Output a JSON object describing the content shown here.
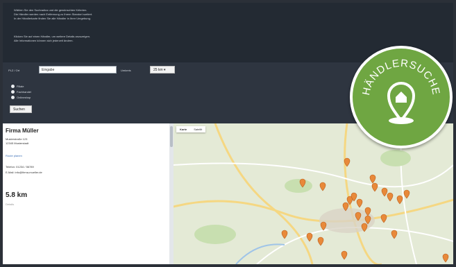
{
  "info": {
    "lines1": [
      "Wählen Sie den Suchradius und die gewünschten Kriterien.",
      "Die Händler werden nach Entfernung zu Ihrem Standort sortiert.",
      "In der Händlerkarte finden Sie alle Händler in Ihrer Umgebung."
    ],
    "lines2": [
      "Klicken Sie auf einen Händler, um weitere Details anzuzeigen.",
      "Alle Informationen können sich jederzeit ändern."
    ]
  },
  "search": {
    "label_plz": "PLZ / Ort",
    "input_value": "Eingabe",
    "label_radius": "Umkreis",
    "radius_value": "25 km",
    "options": [
      "Filiale",
      "Fachhandel",
      "Onlineshop"
    ],
    "submit_label": "Suchen"
  },
  "result": {
    "name": "Firma Müller",
    "street": "Musterstraße 123",
    "city": "12345 Musterstadt",
    "route_link": "Route planen",
    "phone": "Telefon: 01234 / 56789",
    "email": "E-Mail: info@firma-mueller.de",
    "distance": "5.8 km",
    "more": "Details"
  },
  "map": {
    "tab_map": "Karte",
    "tab_satellite": "Satellit"
  },
  "badge": {
    "title": "HÄNDLERSUCHE",
    "color": "#6fa642"
  },
  "colors": {
    "pin": "#e8893a",
    "background": "#232a33"
  }
}
